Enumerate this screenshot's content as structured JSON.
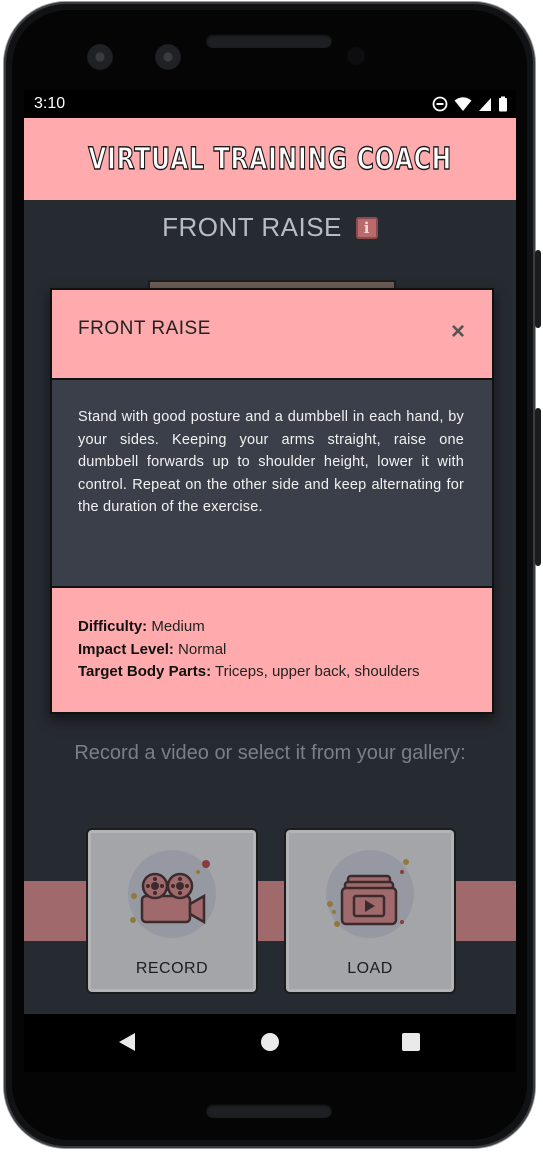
{
  "status": {
    "time": "3:10"
  },
  "app": {
    "title": "VIRTUAL TRAINING COACH"
  },
  "exercise": {
    "name": "FRONT RAISE",
    "info_icon": "info-icon"
  },
  "prompt": "Record a video or select it from your gallery:",
  "actions": [
    {
      "label": "RECORD",
      "icon": "video-camera-icon"
    },
    {
      "label": "LOAD",
      "icon": "video-folder-icon"
    }
  ],
  "dialog": {
    "title": "FRONT RAISE",
    "close": "×",
    "description": "Stand with good posture and a dumbbell in each hand, by your sides. Keeping your arms straight, raise one dumbbell forwards up to shoulder height, lower it with control. Repeat on the other side and keep alternating for the duration of the exercise.",
    "difficulty_label": "Difficulty:",
    "difficulty": "Medium",
    "impact_label": "Impact Level:",
    "impact": "Normal",
    "target_label": "Target Body Parts:",
    "target": "Triceps, upper back, shoulders"
  },
  "colors": {
    "accent": "#ffabad",
    "background": "#262a31",
    "dialog_body": "#3a3f49"
  }
}
